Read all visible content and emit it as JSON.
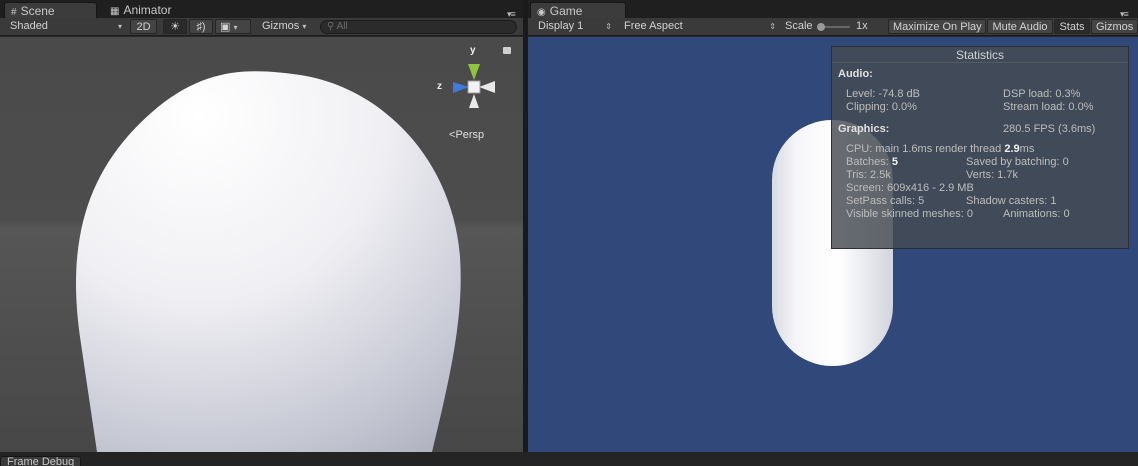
{
  "scene_panel": {
    "tabs": [
      {
        "label": "Scene",
        "icon": "scene-grid-icon",
        "active": true
      },
      {
        "label": "Animator",
        "icon": "animator-icon",
        "active": false
      }
    ],
    "toolbar": {
      "shading_mode": "Shaded",
      "two_d_label": "2D",
      "gizmos_label": "Gizmos",
      "search_placeholder": "All"
    },
    "gizmo": {
      "y_label": "y",
      "z_label": "z",
      "projection_label": "Persp"
    }
  },
  "game_panel": {
    "tab": {
      "label": "Game",
      "icon": "game-controller-icon"
    },
    "toolbar": {
      "display": "Display 1",
      "aspect": "Free Aspect",
      "scale_label": "Scale",
      "scale_value": "1x",
      "maximize_on_play": "Maximize On Play",
      "mute_audio": "Mute Audio",
      "stats": "Stats",
      "gizmos": "Gizmos"
    },
    "statistics": {
      "title": "Statistics",
      "audio_heading": "Audio:",
      "level": "Level: -74.8 dB",
      "dsp_load": "DSP load: 0.3%",
      "clipping": "Clipping: 0.0%",
      "stream_load": "Stream load: 0.0%",
      "graphics_heading": "Graphics:",
      "fps": "280.5 FPS (3.6ms)",
      "cpu_prefix": "CPU: main 1.6ms  render thread ",
      "cpu_render_value": "2.9",
      "cpu_suffix": "ms",
      "batches_prefix": "Batches: ",
      "batches_value": "5",
      "saved_by_batching": "Saved by batching: 0",
      "tris": "Tris: 2.5k",
      "verts": "Verts: 1.7k",
      "screen": "Screen: 609x416 - 2.9 MB",
      "setpass": "SetPass calls: 5",
      "shadow_casters": "Shadow casters: 1",
      "visible_skinned": "Visible skinned meshes: 0",
      "animations": "Animations: 0"
    }
  },
  "bottom_panel": {
    "tab": "Frame Debug"
  },
  "colors": {
    "game_background": "#31487a",
    "gizmo_y": "#8cc63f",
    "gizmo_z": "#3f7ae0"
  }
}
